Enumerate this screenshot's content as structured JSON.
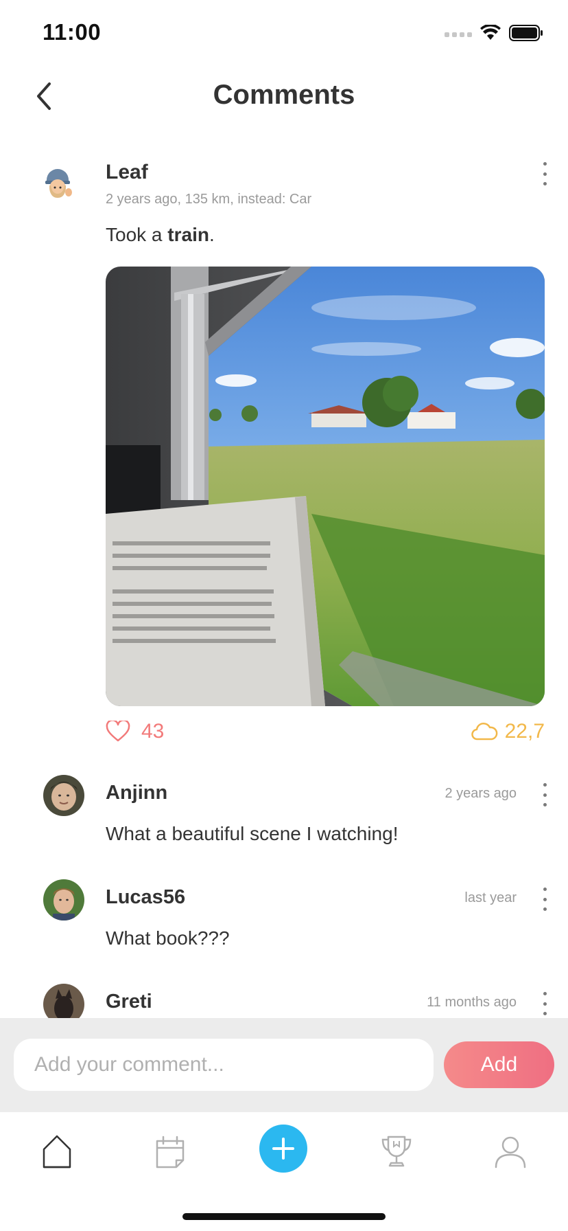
{
  "status_bar": {
    "time": "11:00"
  },
  "header": {
    "title": "Comments"
  },
  "post": {
    "username": "Leaf",
    "meta": "2 years ago, 135 km, instead: Car",
    "text_prefix": "Took a ",
    "text_bold": "train",
    "text_suffix": ".",
    "likes": "43",
    "co2_saved": "22,7"
  },
  "comments": [
    {
      "username": "Anjinn",
      "time": "2 years ago",
      "text": "What a beautiful scene I watching!"
    },
    {
      "username": "Lucas56",
      "time": "last year",
      "text": "What book???"
    },
    {
      "username": "Greti",
      "time": "11 months ago",
      "text": ""
    }
  ],
  "comment_box": {
    "placeholder": "Add your comment...",
    "add_label": "Add"
  },
  "tabs": [
    {
      "icon": "home-icon"
    },
    {
      "icon": "calendar-icon"
    },
    {
      "icon": "plus-icon"
    },
    {
      "icon": "trophy-icon"
    },
    {
      "icon": "profile-icon"
    }
  ],
  "colors": {
    "accent_blue": "#2bb8f0",
    "like_red": "#f27a7a",
    "co2_yellow": "#f2b84a",
    "add_button": "#ef6f82"
  }
}
